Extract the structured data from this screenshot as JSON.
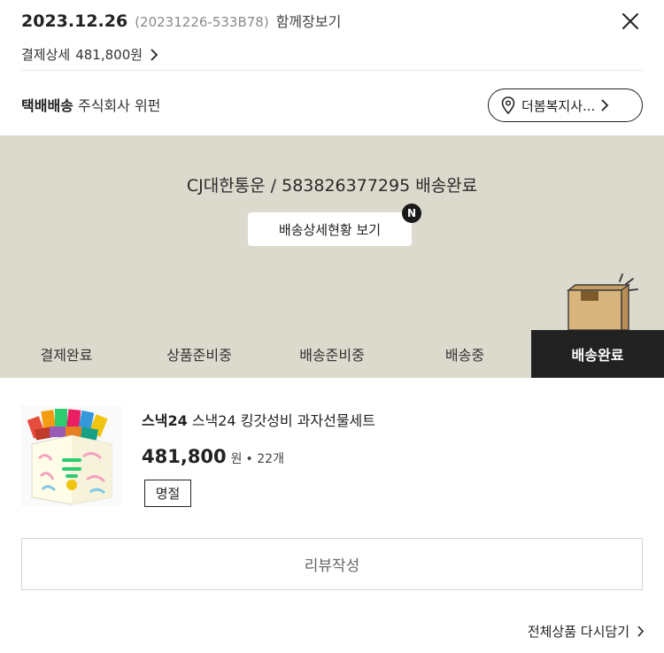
{
  "header": {
    "date": "2023.12.26",
    "order_no": "(20231226-533B78)",
    "together_label": "함께장보기",
    "payment_label": "결제상세",
    "payment_amount": "481,800원"
  },
  "delivery": {
    "type_label": "택배배송",
    "company": "주식회사 위펀",
    "address_button": "더봄복지사..."
  },
  "tracking": {
    "text": "CJ대한통운 / 583826377295 배송완료",
    "detail_button": "배송상세현황 보기",
    "new_badge": "N"
  },
  "steps": [
    {
      "label": "결제완료",
      "active": false
    },
    {
      "label": "상품준비중",
      "active": false
    },
    {
      "label": "배송준비중",
      "active": false
    },
    {
      "label": "배송중",
      "active": false
    },
    {
      "label": "배송완료",
      "active": true
    }
  ],
  "product": {
    "brand": "스낵24",
    "name": "스낵24 킹갓성비 과자선물세트",
    "price": "481,800",
    "currency": "원",
    "quantity": "• 22개",
    "status_badge": "명절",
    "image_icon": "snack-gift-box-image"
  },
  "actions": {
    "review_button": "리뷰작성",
    "readd_all": "전체상품 다시담기"
  },
  "colors": {
    "banner_bg": "#dcd9cd",
    "active_step_bg": "#222222",
    "box_color": "#d8b57c"
  }
}
